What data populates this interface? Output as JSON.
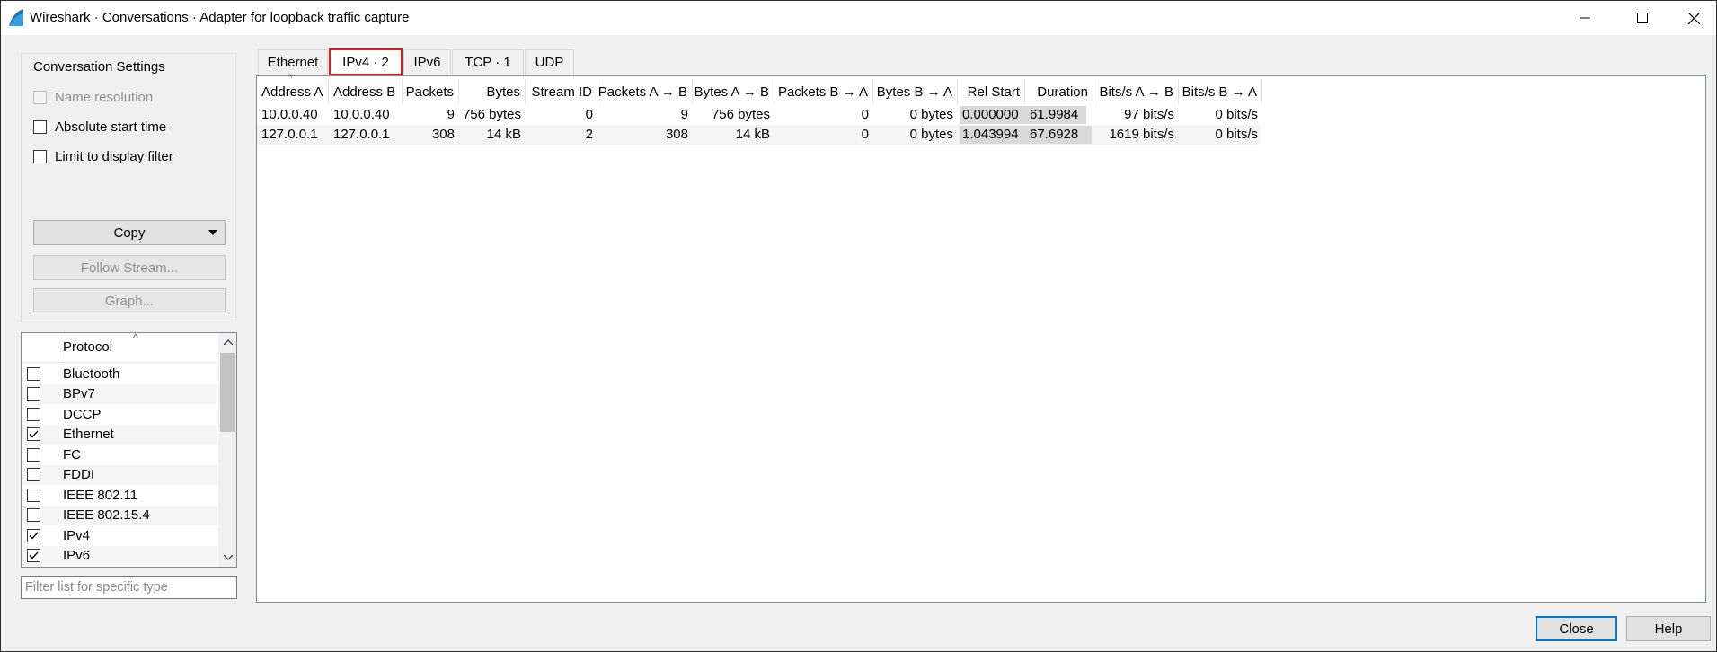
{
  "window": {
    "title": "Wireshark · Conversations · Adapter for loopback traffic capture"
  },
  "settings": {
    "group_title": "Conversation Settings",
    "name_resolution": {
      "label": "Name resolution",
      "checked": false,
      "enabled": false
    },
    "absolute_start_time": {
      "label": "Absolute start time",
      "checked": false
    },
    "limit_display_filter": {
      "label": "Limit to display filter",
      "checked": false
    },
    "copy_label": "Copy",
    "follow_stream_label": "Follow Stream...",
    "graph_label": "Graph..."
  },
  "protocol_list": {
    "header": "Protocol",
    "items": [
      {
        "label": "Bluetooth",
        "checked": false
      },
      {
        "label": "BPv7",
        "checked": false
      },
      {
        "label": "DCCP",
        "checked": false
      },
      {
        "label": "Ethernet",
        "checked": true
      },
      {
        "label": "FC",
        "checked": false
      },
      {
        "label": "FDDI",
        "checked": false
      },
      {
        "label": "IEEE 802.11",
        "checked": false
      },
      {
        "label": "IEEE 802.15.4",
        "checked": false
      },
      {
        "label": "IPv4",
        "checked": true
      },
      {
        "label": "IPv6",
        "checked": true
      }
    ]
  },
  "filter": {
    "placeholder": "Filter list for specific type",
    "value": ""
  },
  "tabs": [
    {
      "label": "Ethernet",
      "active": false
    },
    {
      "label": "IPv4 · 2",
      "active": true
    },
    {
      "label": "IPv6",
      "active": false
    },
    {
      "label": "TCP · 1",
      "active": false
    },
    {
      "label": "UDP",
      "active": false
    }
  ],
  "table": {
    "columns": [
      "Address A",
      "Address B",
      "Packets",
      "Bytes",
      "Stream ID",
      "Packets A → B",
      "Bytes A → B",
      "Packets B → A",
      "Bytes B → A",
      "Rel Start",
      "Duration",
      "Bits/s A → B",
      "Bits/s B → A"
    ],
    "rows": [
      [
        "10.0.0.40",
        "10.0.0.40",
        "9",
        "756 bytes",
        "0",
        "9",
        "756 bytes",
        "0",
        "0 bytes",
        "0.000000",
        "61.9984",
        "97 bits/s",
        "0 bits/s"
      ],
      [
        "127.0.0.1",
        "127.0.0.1",
        "308",
        "14 kB",
        "2",
        "308",
        "14 kB",
        "0",
        "0 bytes",
        "1.043994",
        "67.6928",
        "1619 bits/s",
        "0 bits/s"
      ]
    ]
  },
  "buttons": {
    "close": "Close",
    "help": "Help"
  },
  "colors": {
    "active_tab_outline": "#e0191c",
    "default_button_border": "#0078d7",
    "timeline_bar": "#d9d9d9"
  }
}
